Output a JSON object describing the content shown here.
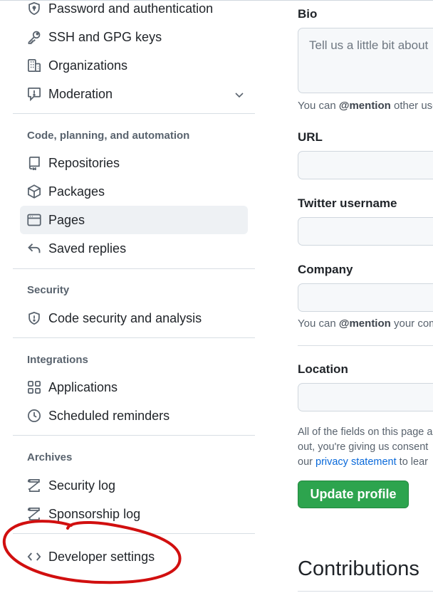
{
  "sidebar": {
    "items_top": [
      {
        "label": "Password and authentication",
        "icon": "shield-lock-icon"
      },
      {
        "label": "SSH and GPG keys",
        "icon": "key-icon"
      },
      {
        "label": "Organizations",
        "icon": "organization-icon"
      },
      {
        "label": "Moderation",
        "icon": "report-icon"
      }
    ],
    "sections": [
      {
        "heading": "Code, planning, and automation",
        "items": [
          {
            "label": "Repositories",
            "icon": "repo-icon"
          },
          {
            "label": "Packages",
            "icon": "package-icon"
          },
          {
            "label": "Pages",
            "icon": "browser-icon",
            "active": true
          },
          {
            "label": "Saved replies",
            "icon": "reply-icon"
          }
        ]
      },
      {
        "heading": "Security",
        "items": [
          {
            "label": "Code security and analysis",
            "icon": "shield-icon"
          }
        ]
      },
      {
        "heading": "Integrations",
        "items": [
          {
            "label": "Applications",
            "icon": "apps-icon"
          },
          {
            "label": "Scheduled reminders",
            "icon": "clock-icon"
          }
        ]
      },
      {
        "heading": "Archives",
        "items": [
          {
            "label": "Security log",
            "icon": "log-icon"
          },
          {
            "label": "Sponsorship log",
            "icon": "log-icon"
          }
        ]
      }
    ],
    "developer_settings": {
      "label": "Developer settings",
      "icon": "code-icon"
    }
  },
  "form": {
    "bio": {
      "label": "Bio",
      "placeholder": "Tell us a little bit about",
      "help_prefix": "You can ",
      "help_mention": "@mention",
      "help_suffix": " other use"
    },
    "url": {
      "label": "URL",
      "value": ""
    },
    "twitter": {
      "label": "Twitter username",
      "value": ""
    },
    "company": {
      "label": "Company",
      "value": "",
      "help_prefix": "You can ",
      "help_mention": "@mention",
      "help_suffix": " your com"
    },
    "location": {
      "label": "Location",
      "value": ""
    },
    "notice": {
      "line1": "All of the fields on this page a",
      "line2": "out, you're giving us consent",
      "line3_prefix": "our ",
      "line3_link": "privacy statement",
      "line3_suffix": " to lear"
    },
    "update_button": "Update profile"
  },
  "contributions_heading": "Contributions",
  "colors": {
    "accent_green": "#2da44e",
    "link_blue": "#0969da",
    "annotation_red": "#d10f0f"
  }
}
